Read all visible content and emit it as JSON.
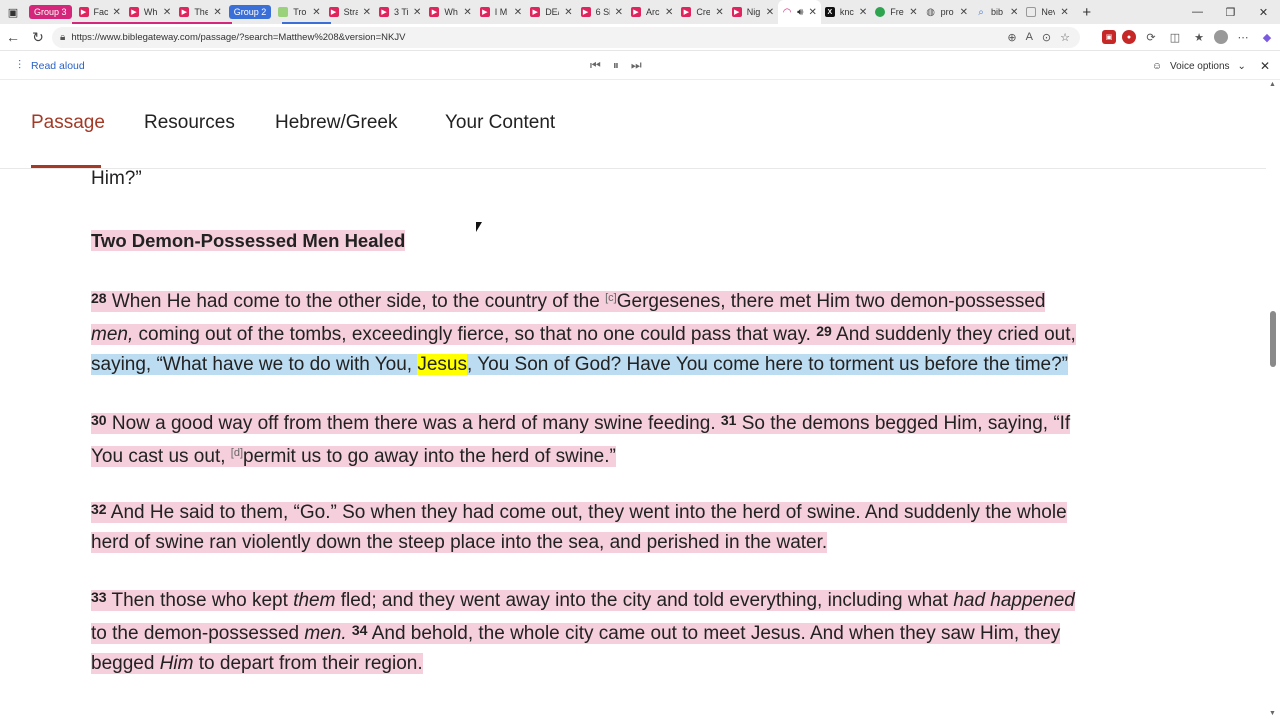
{
  "tabs": {
    "group1_label": "Group 3",
    "group1_color": "#d4267a",
    "group2_label": "Group 2",
    "group2_color": "#3b6fd8",
    "items": [
      {
        "title": "Fac",
        "fav": "#e0245e"
      },
      {
        "title": "Wh",
        "fav": "#e0245e"
      },
      {
        "title": "The",
        "fav": "#e0245e"
      },
      {
        "title": "Tro",
        "fav": "#9ad17b"
      },
      {
        "title": "Stra",
        "fav": "#e0245e"
      },
      {
        "title": "3 Ti",
        "fav": "#e0245e"
      },
      {
        "title": "Wh",
        "fav": "#e0245e"
      },
      {
        "title": "I M",
        "fav": "#e0245e"
      },
      {
        "title": "DE/",
        "fav": "#e0245e"
      },
      {
        "title": "6 Si",
        "fav": "#e0245e"
      },
      {
        "title": "Arc",
        "fav": "#e0245e"
      },
      {
        "title": "Cre",
        "fav": "#e0245e"
      },
      {
        "title": "Nig",
        "fav": "#e0245e"
      },
      {
        "title": "",
        "fav": "#ffffff"
      },
      {
        "title": "knc",
        "fav": "#111111"
      },
      {
        "title": "Fre",
        "fav": "#2ea44f"
      },
      {
        "title": "pro",
        "fav": "#777777"
      },
      {
        "title": "bib",
        "fav": "#4a7bd0"
      },
      {
        "title": "Nev",
        "fav": "#888888"
      }
    ]
  },
  "address_bar": {
    "url": "https://www.biblegateway.com/passage/?search=Matthew%208&version=NKJV"
  },
  "read_aloud": {
    "label": "Read aloud",
    "voice_options": "Voice options"
  },
  "page_tabs": {
    "passage": "Passage",
    "resources": "Resources",
    "hebrew_greek": "Hebrew/Greek",
    "your_content": "Your Content"
  },
  "passage": {
    "prev_tail": "Him?”",
    "heading": "Two Demon-Possessed Men Healed",
    "v28_num": "28",
    "v28_a": "When He had come to the other side, to the country of the ",
    "v28_fn": "[c]",
    "v28_b": "Gergesenes, there met Him two demon-possessed",
    "v28_c_it": "men,",
    "v28_c": " coming out of the tombs, exceedingly fierce, so that no one could pass that way. ",
    "v29_num": "29",
    "v29_a": " And suddenly they cried out,",
    "v29_b": "saying, “What have we to do with You, ",
    "v29_jesus": "Jesus",
    "v29_c": ", You Son of God? Have You come here to torment us before the time?”",
    "v30_num": "30",
    "v30": " Now a good way off from them there was a herd of many swine feeding. ",
    "v31_num": "31",
    "v31_a": " So the demons begged Him, saying, “If",
    "v31_b": "You cast us out, ",
    "v31_fn": "[d]",
    "v31_c": "permit us to go away into the herd of swine.”",
    "v32_num": "32",
    "v32_a": " And He said to them, “Go.” So when they had come out, they went into the herd of swine. And suddenly the whole",
    "v32_b": "herd of swine ran violently down the steep place into the sea, and perished in the water.",
    "v33_num": "33",
    "v33_a": " Then those who kept ",
    "v33_it1": "them",
    "v33_b": " fled; and they went away into the city and told everything, including what ",
    "v33_it2": "had happened",
    "v33_c": "to the demon-possessed ",
    "v33_it3": "men.",
    "v34_num": "34",
    "v34_a": " And behold, the whole city came out to meet Jesus. And when they saw Him, they",
    "v34_b": "begged ",
    "v34_it": "Him",
    "v34_c": " to depart from their region."
  },
  "colors": {
    "highlight_pink": "#f5cfdc",
    "highlight_blue": "#bcdcf2",
    "highlight_yellow": "#ffff00",
    "accent": "#a33a26"
  }
}
